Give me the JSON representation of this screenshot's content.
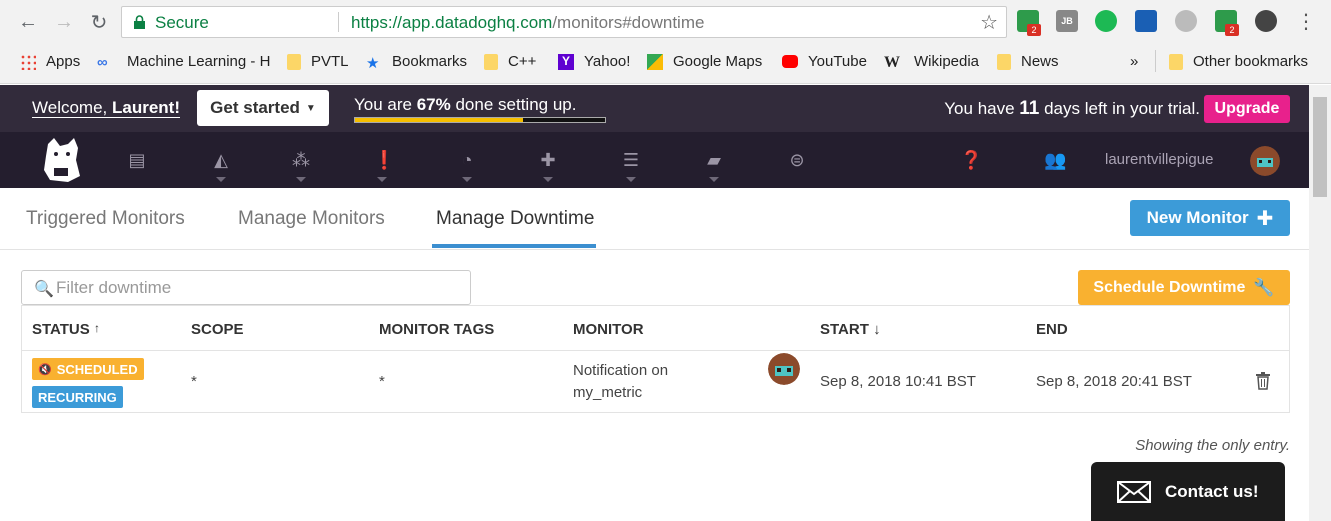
{
  "browser": {
    "secure_label": "Secure",
    "url_host": "https://app.datadoghq.com",
    "url_path": "/monitors#downtime",
    "ext_badge_1": "2",
    "ext_badge_2": "2",
    "ext_jb": "JB"
  },
  "bookmarks": [
    {
      "label": "Apps",
      "icon": "apps-grid-icon"
    },
    {
      "label": "Machine Learning - H",
      "icon": "infinity-icon"
    },
    {
      "label": "PVTL",
      "icon": "folder-icon"
    },
    {
      "label": "Bookmarks",
      "icon": "star-icon"
    },
    {
      "label": "C++",
      "icon": "folder-icon"
    },
    {
      "label": "Yahoo!",
      "icon": "yahoo-icon"
    },
    {
      "label": "Google Maps",
      "icon": "maps-icon"
    },
    {
      "label": "YouTube",
      "icon": "youtube-icon"
    },
    {
      "label": "Wikipedia",
      "icon": "wikipedia-icon"
    },
    {
      "label": "News",
      "icon": "folder-icon"
    },
    {
      "label": "»",
      "icon": "overflow-icon"
    },
    {
      "label": "Other bookmarks",
      "icon": "folder-icon"
    }
  ],
  "header": {
    "welcome_prefix": "Welcome, ",
    "welcome_name": "Laurent!",
    "get_started": "Get started",
    "setup_prefix": "You are ",
    "setup_percent": "67%",
    "setup_suffix": " done setting up.",
    "setup_progress": 0.67,
    "trial_prefix": "You have ",
    "trial_days": "11",
    "trial_suffix": " days left in your trial.",
    "upgrade": "Upgrade"
  },
  "nav": {
    "username": "laurentvillepigue"
  },
  "tabs": [
    {
      "label": "Triggered Monitors"
    },
    {
      "label": "Manage Monitors"
    },
    {
      "label": "Manage Downtime"
    }
  ],
  "new_monitor": "New Monitor",
  "filter": {
    "placeholder": "Filter downtime",
    "value": ""
  },
  "schedule_downtime": "Schedule Downtime",
  "table": {
    "headers": {
      "status": "STATUS",
      "status_sort": "↑",
      "scope": "SCOPE",
      "monitor_tags": "MONITOR TAGS",
      "monitor": "MONITOR",
      "start": "START",
      "start_sort": "↓",
      "end": "END"
    },
    "rows": [
      {
        "badge_scheduled": "SCHEDULED",
        "badge_recurring": "RECURRING",
        "scope": "*",
        "monitor_tags": "*",
        "monitor_line1": "Notification on",
        "monitor_line2": "my_metric",
        "start": "Sep 8, 2018 10:41 BST",
        "end": "Sep 8, 2018 20:41 BST"
      }
    ]
  },
  "entry_note": "Showing the only entry.",
  "contact": "Contact us!",
  "colors": {
    "accent_blue": "#3c9bd8",
    "accent_orange": "#f9b130",
    "upgrade_pink": "#e8218c",
    "header_bg": "#322b3b",
    "nav_bg": "#241e2e"
  }
}
